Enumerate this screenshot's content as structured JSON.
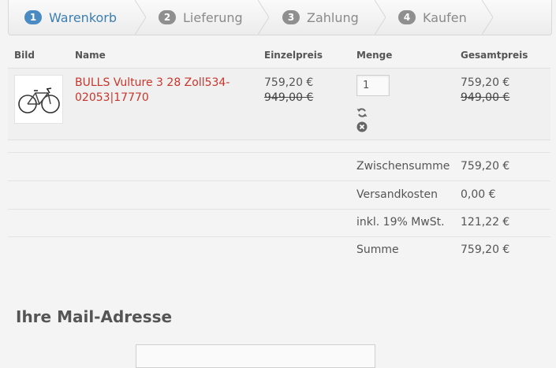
{
  "steps": [
    {
      "num": "1",
      "label": "Warenkorb",
      "active": true
    },
    {
      "num": "2",
      "label": "Lieferung",
      "active": false
    },
    {
      "num": "3",
      "label": "Zahlung",
      "active": false
    },
    {
      "num": "4",
      "label": "Kaufen",
      "active": false
    }
  ],
  "table": {
    "headers": {
      "image": "Bild",
      "name": "Name",
      "unit_price": "Einzelpreis",
      "quantity": "Menge",
      "total_price": "Gesamtpreis"
    },
    "items": [
      {
        "name": "BULLS Vulture 3 28 Zoll534-02053|17770",
        "unit_price": "759,20 €",
        "unit_price_old": "949,00 €",
        "quantity": "1",
        "total_price": "759,20 €",
        "total_price_old": "949,00 €"
      }
    ]
  },
  "summary": {
    "subtotal_label": "Zwischensumme",
    "subtotal_value": "759,20 €",
    "shipping_label": "Versandkosten",
    "shipping_value": "0,00 €",
    "vat_label": "inkl. 19% MwSt.",
    "vat_value": "121,22 €",
    "total_label": "Summe",
    "total_value": "759,20 €"
  },
  "mail": {
    "heading": "Ihre Mail-Adresse"
  },
  "colors": {
    "accent": "#4a8bc3",
    "link": "#c8352b"
  },
  "icons": {
    "refresh": "refresh-icon",
    "remove": "remove-icon"
  }
}
